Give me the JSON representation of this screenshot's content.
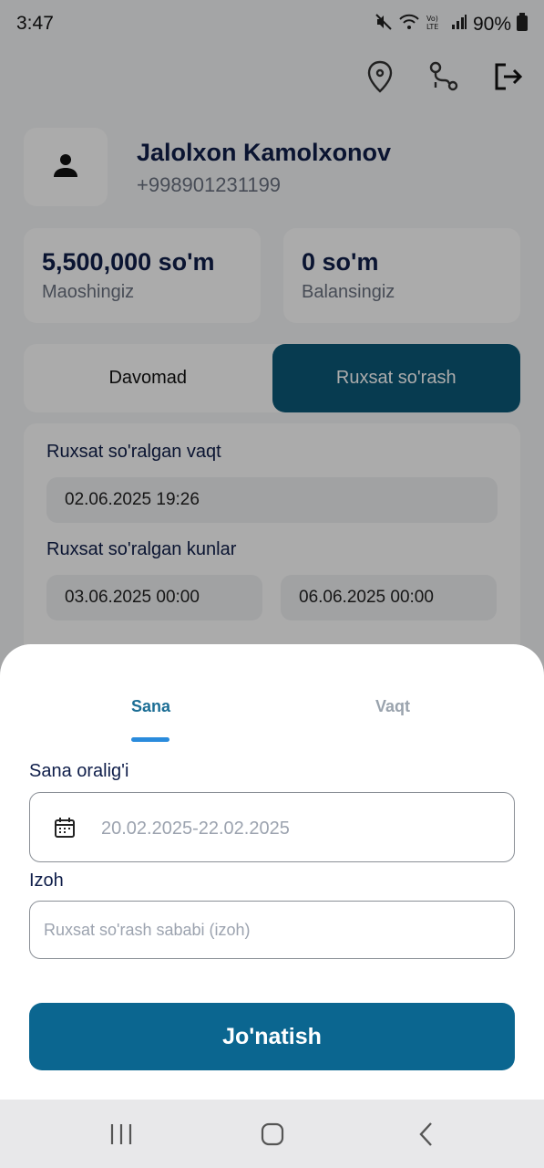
{
  "status_bar": {
    "time": "3:47",
    "battery": "90%",
    "icons": [
      "mute-icon",
      "wifi-icon",
      "volte-icon",
      "signal-icon",
      "battery-icon"
    ]
  },
  "header": {
    "actions": [
      "location-pin-icon",
      "route-icon",
      "logout-icon"
    ]
  },
  "profile": {
    "name": "Jalolxon Kamolxonov",
    "phone": "+998901231199",
    "avatar_icon": "person-icon"
  },
  "stats": [
    {
      "value": "5,500,000 so'm",
      "label": "Maoshingiz"
    },
    {
      "value": "0 so'm",
      "label": "Balansingiz"
    }
  ],
  "segments": {
    "items": [
      "Davomad",
      "Ruxsat so'rash"
    ],
    "active": 1
  },
  "request": {
    "asked_time_label": "Ruxsat so'ralgan vaqt",
    "asked_time_value": "02.06.2025 19:26",
    "asked_days_label": "Ruxsat so'ralgan kunlar",
    "from": "03.06.2025 00:00",
    "to": "06.06.2025 00:00"
  },
  "sheet": {
    "tabs": [
      "Sana",
      "Vaqt"
    ],
    "active_tab": 0,
    "range_label": "Sana oralig'i",
    "range_value": "20.02.2025-22.02.2025",
    "note_label": "Izoh",
    "note_placeholder": "Ruxsat so'rash sababi (izoh)",
    "submit_label": "Jo'natish"
  },
  "colors": {
    "primary": "#0b6690",
    "active_segment": "#0b5878",
    "tab_active": "#1c6e95",
    "tab_underline": "#2a8bdc",
    "title_text": "#0f1e4a"
  }
}
